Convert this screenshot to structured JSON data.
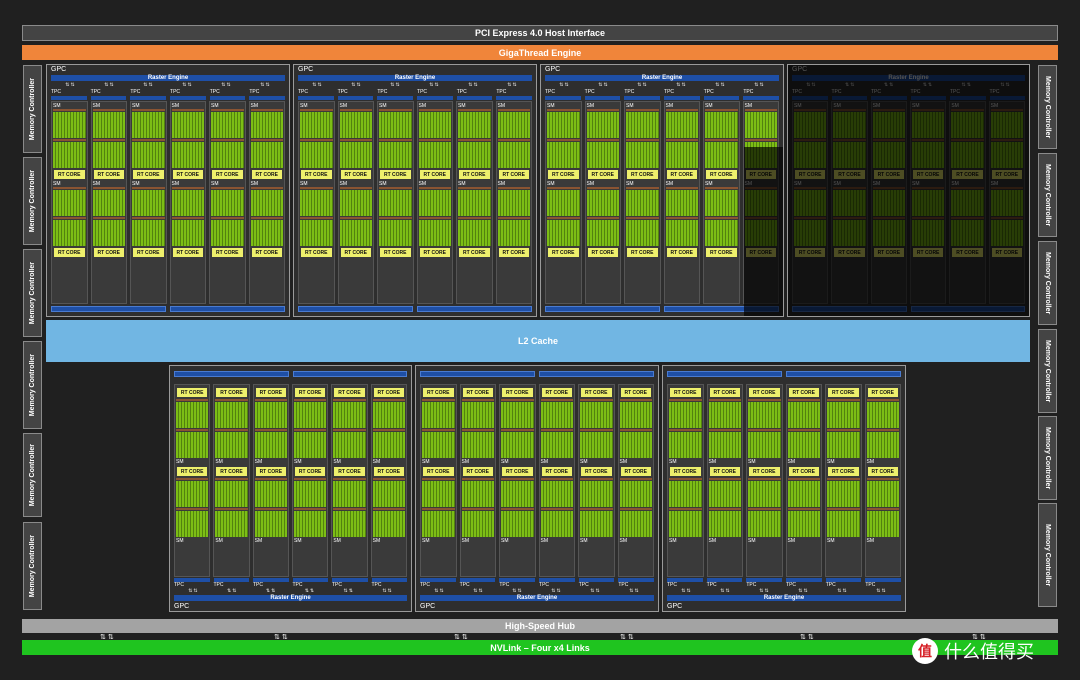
{
  "pcie": "PCI Express 4.0 Host Interface",
  "giga": "GigaThread Engine",
  "l2": "L2 Cache",
  "hub": "High-Speed Hub",
  "nvlink": "NVLink – Four x4 Links",
  "memory_controller": "Memory Controller",
  "gpc": "GPC",
  "raster": "Raster Engine",
  "tpc": "TPC",
  "polymorph": "PolyMorph Engine",
  "sm": "SM",
  "rt_core": "RT CORE",
  "watermark": "什么值得买",
  "colors": {
    "background": "#202020",
    "giga": "#f0853a",
    "l2": "#71b6e3",
    "hub": "#a3a3a3",
    "nvlink": "#1fc41f",
    "raster": "#1e4fa6",
    "rt_core": "#eef06c",
    "cuda_cores": "#8fd41c"
  },
  "disabled_units": "last GPC of top row disabled, last TPC of third GPC disabled"
}
